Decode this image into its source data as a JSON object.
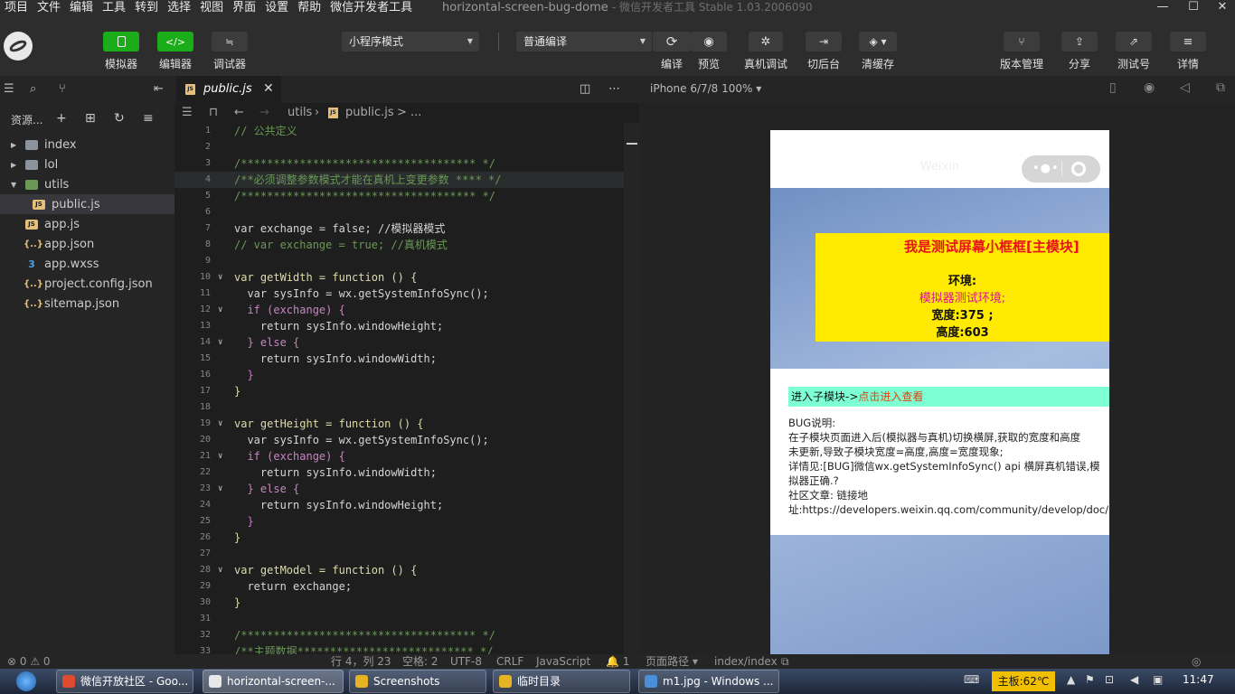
{
  "menu": [
    "项目",
    "文件",
    "编辑",
    "工具",
    "转到",
    "选择",
    "视图",
    "界面",
    "设置",
    "帮助",
    "微信开发者工具"
  ],
  "window": {
    "title": "horizontal-screen-bug-dome",
    "subtitle": "- 微信开发者工具 Stable 1.03.2006090"
  },
  "window_controls": [
    "—",
    "☐",
    "✕"
  ],
  "toolbar": {
    "simulator_label": "模拟器",
    "editor_label": "编辑器",
    "debugger_label": "调试器",
    "editor_icon": "</>",
    "debugger_icon": "≒",
    "mode_select": "小程序模式",
    "compile_select": "普通编译",
    "compile_label": "编译",
    "preview_label": "预览",
    "realdebug_label": "真机调试",
    "background_label": "切后台",
    "clearcache_label": "清缓存",
    "version_label": "版本管理",
    "share_label": "分享",
    "testno_label": "测试号",
    "details_label": "详情"
  },
  "explorer": {
    "header": "资源...",
    "items": [
      {
        "name": "index",
        "kind": "folder"
      },
      {
        "name": "lol",
        "kind": "folder"
      },
      {
        "name": "utils",
        "kind": "folder-open"
      },
      {
        "name": "public.js",
        "kind": "js"
      },
      {
        "name": "app.js",
        "kind": "js"
      },
      {
        "name": "app.json",
        "kind": "json"
      },
      {
        "name": "app.wxss",
        "kind": "wxss"
      },
      {
        "name": "project.config.json",
        "kind": "json"
      },
      {
        "name": "sitemap.json",
        "kind": "json"
      }
    ],
    "js_badge": "JS",
    "json_badge": "{..}",
    "wxss_badge": "3"
  },
  "editor": {
    "tab": "public.js",
    "tab_close": "✕",
    "breadcrumb_folder": "utils",
    "breadcrumb_file": "public.js",
    "breadcrumb_more": "> ...",
    "lines": [
      {
        "n": "1",
        "t": "// 公共定义"
      },
      {
        "n": "2",
        "t": ""
      },
      {
        "n": "3",
        "t": "/************************************ */"
      },
      {
        "n": "4",
        "t": "/**必须调整参数模式才能在真机上变更参数 **** */"
      },
      {
        "n": "5",
        "t": "/************************************ */"
      },
      {
        "n": "6",
        "t": ""
      },
      {
        "n": "7",
        "t": "var exchange = false; //模拟器模式"
      },
      {
        "n": "8",
        "t": "// var exchange = true; //真机模式"
      },
      {
        "n": "9",
        "t": ""
      },
      {
        "n": "10",
        "t": "var getWidth = function () {"
      },
      {
        "n": "11",
        "t": "  var sysInfo = wx.getSystemInfoSync();"
      },
      {
        "n": "12",
        "t": "  if (exchange) {"
      },
      {
        "n": "13",
        "t": "    return sysInfo.windowHeight;"
      },
      {
        "n": "14",
        "t": "  } else {"
      },
      {
        "n": "15",
        "t": "    return sysInfo.windowWidth;"
      },
      {
        "n": "16",
        "t": "  }"
      },
      {
        "n": "17",
        "t": "}"
      },
      {
        "n": "18",
        "t": ""
      },
      {
        "n": "19",
        "t": "var getHeight = function () {"
      },
      {
        "n": "20",
        "t": "  var sysInfo = wx.getSystemInfoSync();"
      },
      {
        "n": "21",
        "t": "  if (exchange) {"
      },
      {
        "n": "22",
        "t": "    return sysInfo.windowWidth;"
      },
      {
        "n": "23",
        "t": "  } else {"
      },
      {
        "n": "24",
        "t": "    return sysInfo.windowHeight;"
      },
      {
        "n": "25",
        "t": "  }"
      },
      {
        "n": "26",
        "t": "}"
      },
      {
        "n": "27",
        "t": ""
      },
      {
        "n": "28",
        "t": "var getModel = function () {"
      },
      {
        "n": "29",
        "t": "  return exchange;"
      },
      {
        "n": "30",
        "t": "}"
      },
      {
        "n": "31",
        "t": ""
      },
      {
        "n": "32",
        "t": "/************************************ */"
      },
      {
        "n": "33",
        "t": "/**主题数据*************************** */"
      }
    ]
  },
  "simulator": {
    "device": "iPhone 6/7/8 100% ▾",
    "nav_title": "Weixin",
    "yellow_title": "我是测试屏幕小框框[主模块]",
    "env_label": "环境:",
    "env_value": "模拟器测试环境;",
    "width_line": "宽度:375 ;",
    "height_line": "高度:603",
    "submodule_prefix": "进入子模块->",
    "submodule_link": "点击进入查看",
    "bug_lines": [
      "BUG说明:",
      "在子模块页面进入后(模拟器与真机)切换横屏,获取的宽度和高度",
      "未更新,导致子模块宽度=高度,高度=宽度现象;",
      "详情见:[BUG]微信wx.getSystemInfoSync() api 横屏真机错误,模",
      "拟器正确.?",
      "社区文章: 链接地",
      "址:https://developers.weixin.qq.com/community/develop/doc/"
    ]
  },
  "status": {
    "errors": "⊗ 0  ⚠ 0",
    "position": "行 4，列 23",
    "spaces": "空格: 2",
    "encoding": "UTF-8",
    "eol": "CRLF",
    "language": "JavaScript",
    "notifications": "🔔 1",
    "page_path_label": "页面路径 ▾",
    "page_path": "index/index"
  },
  "taskbar": {
    "items": [
      {
        "label": "微信开放社区 - Goo...",
        "color": "#e04a2f"
      },
      {
        "label": "horizontal-screen-...",
        "color": "#e8e8e8"
      },
      {
        "label": "Screenshots",
        "color": "#e6b422"
      },
      {
        "label": "临时目录",
        "color": "#e6b422"
      },
      {
        "label": "m1.jpg - Windows ...",
        "color": "#4a90d9"
      }
    ],
    "temp": "主板:62℃",
    "clock": "11:47"
  },
  "colors": {
    "accent_green": "#1aad19",
    "yellow_box": "#ffea00",
    "title_red": "#e8121a",
    "env_magenta": "#e0119a",
    "aqua": "#7fffd4"
  }
}
